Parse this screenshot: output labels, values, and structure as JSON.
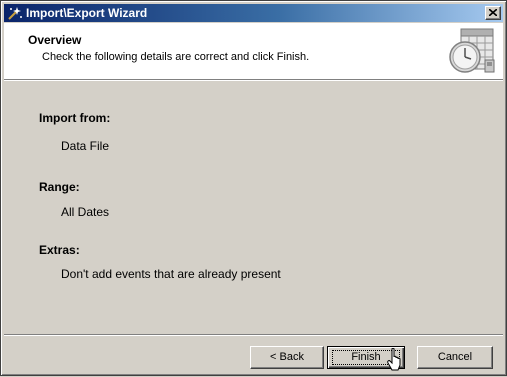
{
  "window": {
    "title": "Import\\Export Wizard",
    "close_symbol": "✕"
  },
  "header": {
    "title": "Overview",
    "subtitle": "Check the following details are correct and click Finish.",
    "icon": "calendar-clock-wizard-icon"
  },
  "details": {
    "import_from": {
      "label": "Import from:",
      "value": "Data File"
    },
    "range": {
      "label": "Range:",
      "value": "All Dates"
    },
    "extras": {
      "label": "Extras:",
      "value": "Don't add events that are already present"
    }
  },
  "buttons": {
    "back": "< Back",
    "finish": "Finish",
    "cancel": "Cancel"
  },
  "colors": {
    "titlebar_start": "#0a246a",
    "titlebar_end": "#a6caf0",
    "face": "#d4d0c8"
  }
}
